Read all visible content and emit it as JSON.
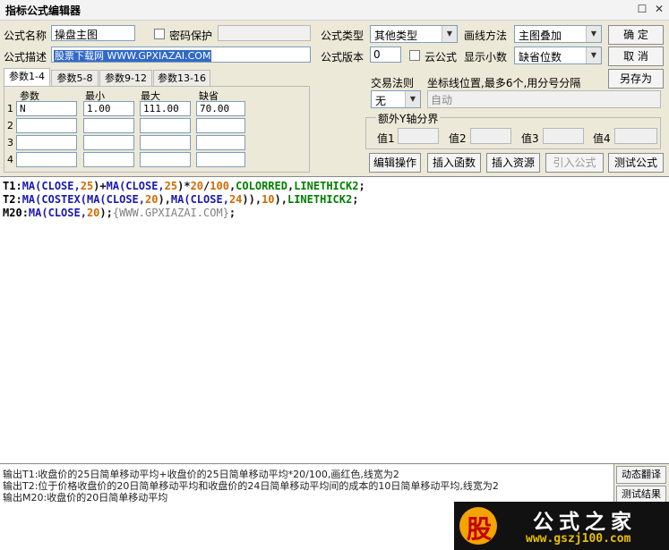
{
  "window": {
    "title": "指标公式编辑器",
    "restore_glyph": "☐",
    "close_glyph": "✕"
  },
  "form": {
    "name_label": "公式名称",
    "name_value": "操盘主图",
    "password_label": "密码保护",
    "password_value": "",
    "desc_label": "公式描述",
    "desc_value": "股票下载网 WWW.GPXIAZAI.COM",
    "type_label": "公式类型",
    "type_value": "其他类型",
    "draw_label": "画线方法",
    "draw_value": "主图叠加",
    "version_label": "公式版本",
    "version_value": "0",
    "cloud_label": "云公式",
    "decimal_label": "显示小数",
    "decimal_value": "缺省位数"
  },
  "buttons": {
    "ok": "确  定",
    "cancel": "取  消",
    "save_as": "另存为"
  },
  "tabs": [
    "参数1-4",
    "参数5-8",
    "参数9-12",
    "参数13-16"
  ],
  "params": {
    "headers": [
      "参数",
      "最小",
      "最大",
      "缺省"
    ],
    "rows": [
      {
        "num": "1",
        "name": "N",
        "min": "1.00",
        "max": "111.00",
        "default": "70.00"
      },
      {
        "num": "2",
        "name": "",
        "min": "",
        "max": "",
        "default": ""
      },
      {
        "num": "3",
        "name": "",
        "min": "",
        "max": "",
        "default": ""
      },
      {
        "num": "4",
        "name": "",
        "min": "",
        "max": "",
        "default": ""
      }
    ]
  },
  "trade": {
    "rule_label": "交易法则",
    "rule_value": "无",
    "coord_label": "坐标线位置,最多6个,用分号分隔",
    "coord_value": "自动"
  },
  "yaxis": {
    "label": "额外Y轴分界",
    "v1": "值1",
    "v2": "值2",
    "v3": "值3",
    "v4": "值4"
  },
  "tools": [
    "编辑操作",
    "插入函数",
    "插入资源",
    "引入公式",
    "测试公式"
  ],
  "code": {
    "line1": [
      "T1",
      ":",
      "MA",
      "(CLOSE,",
      "25",
      ")+",
      "MA",
      "(CLOSE,",
      "25",
      ")*",
      "20",
      "/",
      "100",
      ",",
      "COLORRED",
      ",",
      "LINETHICK2",
      ";"
    ],
    "line2": [
      "T2",
      ":",
      "MA",
      "(",
      "COSTEX",
      "(",
      "MA",
      "(CLOSE,",
      "20",
      "),",
      "MA",
      "(CLOSE,",
      "24",
      ")),",
      "10",
      "),",
      "LINETHICK2",
      ";"
    ],
    "line3": [
      "M20",
      ":",
      "MA",
      "(CLOSE,",
      "20",
      ");",
      "{WWW.GPXIAZAI.COM}",
      ";"
    ]
  },
  "output": [
    "输出T1:收盘价的25日简单移动平均+收盘价的25日简单移动平均*20/100,画红色,线宽为2",
    "输出T2:位于价格收盘价的20日简单移动平均和收盘价的24日简单移动平均间的成本的10日简单移动平均,线宽为2",
    "输出M20:收盘价的20日简单移动平均"
  ],
  "side": {
    "translate": "动态翻译",
    "test_result": "测试结果"
  },
  "watermark": {
    "badge": "股",
    "text": "公式之家",
    "url": "www.gszj100.com"
  }
}
